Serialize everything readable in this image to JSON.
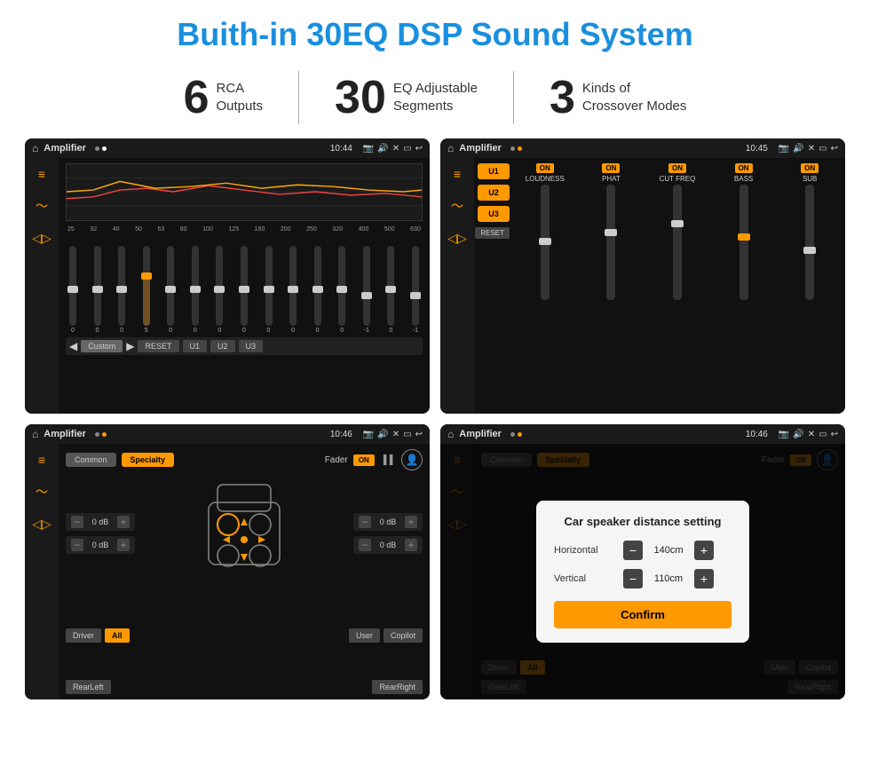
{
  "title": "Buith-in 30EQ DSP Sound System",
  "stats": [
    {
      "number": "6",
      "text_line1": "RCA",
      "text_line2": "Outputs"
    },
    {
      "number": "30",
      "text_line1": "EQ Adjustable",
      "text_line2": "Segments"
    },
    {
      "number": "3",
      "text_line1": "Kinds of",
      "text_line2": "Crossover Modes"
    }
  ],
  "screens": [
    {
      "id": "screen1",
      "status_bar": {
        "title": "Amplifier",
        "time": "10:44"
      },
      "eq_freqs": [
        "25",
        "32",
        "40",
        "50",
        "63",
        "80",
        "100",
        "125",
        "160",
        "200",
        "250",
        "320",
        "400",
        "500",
        "630"
      ],
      "eq_values": [
        "0",
        "0",
        "0",
        "5",
        "0",
        "0",
        "0",
        "0",
        "0",
        "0",
        "0",
        "0",
        "-1",
        "0",
        "-1"
      ],
      "bottom_buttons": [
        "Custom",
        "RESET",
        "U1",
        "U2",
        "U3"
      ]
    },
    {
      "id": "screen2",
      "status_bar": {
        "title": "Amplifier",
        "time": "10:45"
      },
      "presets": [
        "U1",
        "U2",
        "U3"
      ],
      "channels": [
        {
          "label": "LOUDNESS",
          "btn": "ON"
        },
        {
          "label": "PHAT",
          "btn": "ON"
        },
        {
          "label": "CUT FREQ",
          "btn": "ON"
        },
        {
          "label": "BASS",
          "btn": "ON"
        },
        {
          "label": "SUB",
          "btn": "ON"
        }
      ],
      "reset_label": "RESET"
    },
    {
      "id": "screen3",
      "status_bar": {
        "title": "Amplifier",
        "time": "10:46"
      },
      "tabs": [
        "Common",
        "Specialty"
      ],
      "fader_label": "Fader",
      "fader_on": "ON",
      "left_dbs": [
        "0 dB",
        "0 dB"
      ],
      "right_dbs": [
        "0 dB",
        "0 dB"
      ],
      "bottom_buttons": [
        "Driver",
        "All",
        "User",
        "RearLeft",
        "RearRight",
        "Copilot"
      ]
    },
    {
      "id": "screen4",
      "status_bar": {
        "title": "Amplifier",
        "time": "10:46"
      },
      "dialog": {
        "title": "Car speaker distance setting",
        "horizontal_label": "Horizontal",
        "horizontal_value": "140cm",
        "vertical_label": "Vertical",
        "vertical_value": "110cm",
        "confirm_label": "Confirm"
      },
      "bottom_buttons": [
        "Driver",
        "All",
        "User",
        "RearLeft",
        "RearRight",
        "Copilot"
      ]
    }
  ]
}
